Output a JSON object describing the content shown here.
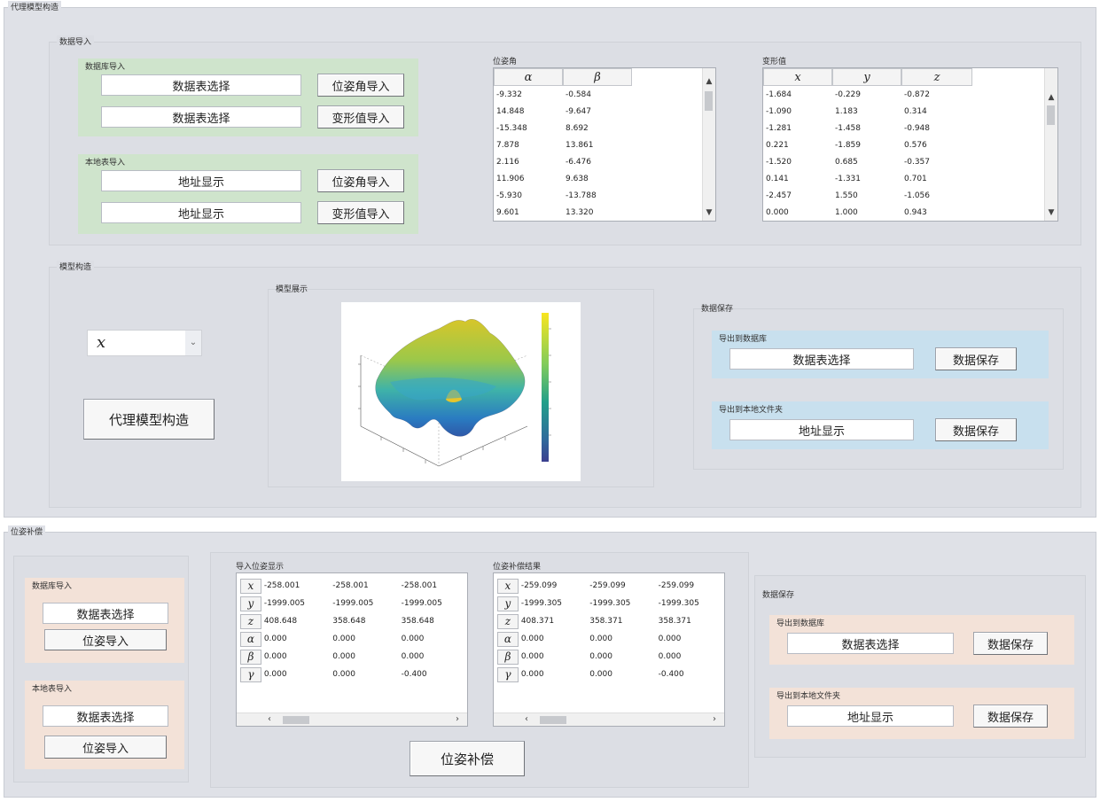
{
  "surrogate_panel": {
    "title": "代理模型构造",
    "import": {
      "title": "数据导入",
      "db_box": {
        "title": "数据库导入",
        "rows": [
          {
            "field": "数据表选择",
            "button": "位姿角导入"
          },
          {
            "field": "数据表选择",
            "button": "变形值导入"
          }
        ]
      },
      "local_box": {
        "title": "本地表导入",
        "rows": [
          {
            "field": "地址显示",
            "button": "位姿角导入"
          },
          {
            "field": "地址显示",
            "button": "变形值导入"
          }
        ]
      },
      "pose_table": {
        "title": "位姿角",
        "headers": [
          "α",
          "β"
        ],
        "rows": [
          [
            "-9.332",
            "-0.584"
          ],
          [
            "14.848",
            "-9.647"
          ],
          [
            "-15.348",
            "8.692"
          ],
          [
            "7.878",
            "13.861"
          ],
          [
            "2.116",
            "-6.476"
          ],
          [
            "11.906",
            "9.638"
          ],
          [
            "-5.930",
            "-13.788"
          ],
          [
            "9.601",
            "13.320"
          ]
        ]
      },
      "deform_table": {
        "title": "变形值",
        "headers": [
          "x",
          "y",
          "z"
        ],
        "rows": [
          [
            "-1.684",
            "-0.229",
            "-0.872"
          ],
          [
            "-1.090",
            "1.183",
            "0.314"
          ],
          [
            "-1.281",
            "-1.458",
            "-0.948"
          ],
          [
            "0.221",
            "-1.859",
            "0.576"
          ],
          [
            "-1.520",
            "0.685",
            "-0.357"
          ],
          [
            "0.141",
            "-1.331",
            "0.701"
          ],
          [
            "-2.457",
            "1.550",
            "-1.056"
          ],
          [
            "0.000",
            "1.000",
            "0.943"
          ]
        ]
      }
    },
    "model": {
      "title": "模型构造",
      "select_value": "x",
      "build_button": "代理模型构造",
      "display_title": "模型展示",
      "save": {
        "title": "数据保存",
        "db": {
          "title": "导出到数据库",
          "field": "数据表选择",
          "button": "数据保存"
        },
        "folder": {
          "title": "导出到本地文件夹",
          "field": "地址显示",
          "button": "数据保存"
        }
      }
    }
  },
  "compensation_panel": {
    "title": "位姿补偿",
    "db_box": {
      "title": "数据库导入",
      "field": "数据表选择",
      "button": "位姿导入"
    },
    "local_box": {
      "title": "本地表导入",
      "field": "数据表选择",
      "button": "位姿导入"
    },
    "import_table": {
      "title": "导入位姿显示",
      "row_labels": [
        "x",
        "y",
        "z",
        "α",
        "β",
        "γ"
      ],
      "rows": [
        [
          "-258.001",
          "-258.001",
          "-258.001"
        ],
        [
          "-1999.005",
          "-1999.005",
          "-1999.005"
        ],
        [
          "408.648",
          "358.648",
          "358.648"
        ],
        [
          "0.000",
          "0.000",
          "0.000"
        ],
        [
          "0.000",
          "0.000",
          "0.000"
        ],
        [
          "0.000",
          "0.000",
          "-0.400"
        ]
      ]
    },
    "result_table": {
      "title": "位姿补偿结果",
      "row_labels": [
        "x",
        "y",
        "z",
        "α",
        "β",
        "γ"
      ],
      "rows": [
        [
          "-259.099",
          "-259.099",
          "-259.099"
        ],
        [
          "-1999.305",
          "-1999.305",
          "-1999.305"
        ],
        [
          "408.371",
          "358.371",
          "358.371"
        ],
        [
          "0.000",
          "0.000",
          "0.000"
        ],
        [
          "0.000",
          "0.000",
          "0.000"
        ],
        [
          "0.000",
          "0.000",
          "-0.400"
        ]
      ]
    },
    "compensate_button": "位姿补偿",
    "save": {
      "title": "数据保存",
      "db": {
        "title": "导出到数据库",
        "field": "数据表选择",
        "button": "数据保存"
      },
      "folder": {
        "title": "导出到本地文件夹",
        "field": "地址显示",
        "button": "数据保存"
      }
    }
  },
  "colors": {
    "panel": "#dfe1e7",
    "green_box": "#cfe4cc",
    "blue_box": "#c8e0ee",
    "peach_box": "#f3e2d8"
  },
  "icons": {
    "scroll_up": "chevron-up-icon",
    "scroll_down": "chevron-down-icon",
    "scroll_left": "chevron-left-icon",
    "scroll_right": "chevron-right-icon",
    "dropdown": "chevron-down-icon"
  }
}
